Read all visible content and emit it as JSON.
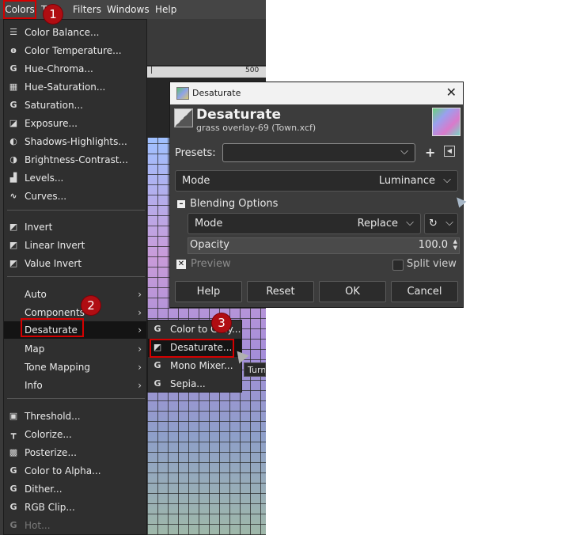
{
  "menubar": {
    "colors": "Colors",
    "filters": "Filters",
    "windows": "Windows",
    "help": "Help",
    "hidden_item": "T"
  },
  "ruler": {
    "tick_label": "500"
  },
  "colors_menu": {
    "items": [
      {
        "label": "Color Balance...",
        "icon": "balance-icon"
      },
      {
        "label": "Color Temperature...",
        "icon": "thermometer-icon"
      },
      {
        "label": "Hue-Chroma...",
        "icon": "gegl-icon"
      },
      {
        "label": "Hue-Saturation...",
        "icon": "hue-saturation-icon"
      },
      {
        "label": "Saturation...",
        "icon": "gegl-icon"
      },
      {
        "label": "Exposure...",
        "icon": "exposure-icon"
      },
      {
        "label": "Shadows-Highlights...",
        "icon": "shadows-icon"
      },
      {
        "label": "Brightness-Contrast...",
        "icon": "brightness-icon"
      },
      {
        "label": "Levels...",
        "icon": "levels-icon"
      },
      {
        "label": "Curves...",
        "icon": "curves-icon"
      },
      {
        "label": "Invert",
        "icon": "invert-icon"
      },
      {
        "label": "Linear Invert",
        "icon": "invert-icon"
      },
      {
        "label": "Value Invert",
        "icon": "invert-icon"
      },
      {
        "label": "Auto",
        "icon": ""
      },
      {
        "label": "Components",
        "icon": ""
      },
      {
        "label": "Desaturate",
        "icon": ""
      },
      {
        "label": "Map",
        "icon": ""
      },
      {
        "label": "Tone Mapping",
        "icon": ""
      },
      {
        "label": "Info",
        "icon": ""
      },
      {
        "label": "Threshold...",
        "icon": "threshold-icon"
      },
      {
        "label": "Colorize...",
        "icon": "colorize-icon"
      },
      {
        "label": "Posterize...",
        "icon": "posterize-icon"
      },
      {
        "label": "Color to Alpha...",
        "icon": "gegl-icon"
      },
      {
        "label": "Dither...",
        "icon": "gegl-icon"
      },
      {
        "label": "RGB Clip...",
        "icon": "gegl-icon"
      },
      {
        "label": "Hot...",
        "icon": "gegl-icon"
      }
    ]
  },
  "submenu": {
    "items": [
      {
        "label": "Color to Gray..."
      },
      {
        "label": "Desaturate..."
      },
      {
        "label": "Mono Mixer..."
      },
      {
        "label": "Sepia..."
      }
    ],
    "tooltip": "Turn"
  },
  "badges": [
    "1",
    "2",
    "3"
  ],
  "dialog": {
    "window_title": "Desaturate",
    "heading": "Desaturate",
    "subtitle": "grass overlay-69 (Town.xcf)",
    "presets_label": "Presets:",
    "presets_value": "",
    "mode_label": "Mode",
    "mode_value": "Luminance",
    "blending_label": "Blending Options",
    "blend_mode_label": "Mode",
    "blend_mode_value": "Replace",
    "opacity_label": "Opacity",
    "opacity_value": "100.0",
    "preview_label": "Preview",
    "split_view_label": "Split view",
    "buttons": {
      "help": "Help",
      "reset": "Reset",
      "ok": "OK",
      "cancel": "Cancel"
    }
  },
  "colors": {
    "accent_red": "#d40000",
    "badge_red": "#b00d12",
    "menu_bg": "#2f2f2f",
    "dialog_bg": "#3c3c3c"
  }
}
